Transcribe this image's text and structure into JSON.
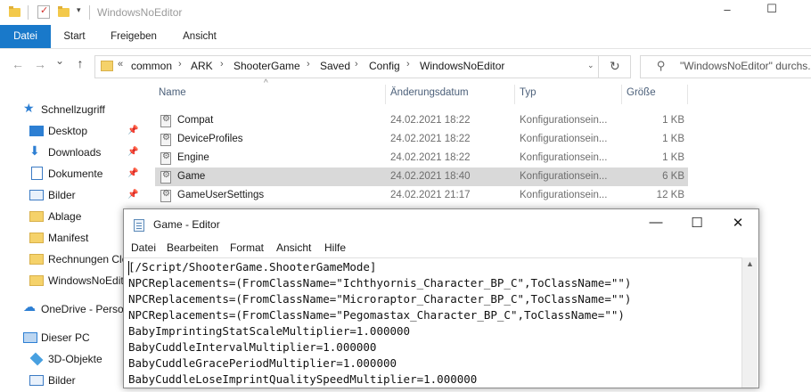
{
  "explorer": {
    "window_title": "WindowsNoEditor",
    "controls": {
      "minimize": "–",
      "maximize": "☐"
    },
    "ribbon_tabs": [
      "Datei",
      "Start",
      "Freigeben",
      "Ansicht"
    ],
    "nav_arrows": {
      "back": "←",
      "forward": "→",
      "recent": "⌄",
      "up": "↑"
    },
    "breadcrumb": [
      "common",
      "ARK",
      "ShooterGame",
      "Saved",
      "Config",
      "WindowsNoEditor"
    ],
    "breadcrumb_overflow": "«",
    "refresh_icon": "↻",
    "search": {
      "placeholder": "\"WindowsNoEditor\" durchs..."
    },
    "sort_indicator": "^",
    "nav_pane": [
      {
        "label": "Schnellzugriff",
        "icon": "star-icon"
      },
      {
        "label": "Desktop",
        "icon": "desktop-icon",
        "pinned": true
      },
      {
        "label": "Downloads",
        "icon": "download-icon",
        "pinned": true
      },
      {
        "label": "Dokumente",
        "icon": "document-icon",
        "pinned": true
      },
      {
        "label": "Bilder",
        "icon": "pictures-icon",
        "pinned": true
      },
      {
        "label": "Ablage",
        "icon": "folder-icon"
      },
      {
        "label": "Manifest",
        "icon": "folder-icon"
      },
      {
        "label": "Rechnungen Clo",
        "icon": "folder-icon"
      },
      {
        "label": "WindowsNoEditor",
        "icon": "folder-icon"
      },
      {
        "label": "OneDrive - Persor",
        "icon": "cloud-icon"
      },
      {
        "label": "Dieser PC",
        "icon": "computer-icon"
      },
      {
        "label": "3D-Objekte",
        "icon": "cube-icon"
      },
      {
        "label": "Bilder",
        "icon": "pictures-icon"
      }
    ],
    "columns": [
      "Name",
      "Änderungsdatum",
      "Typ",
      "Größe"
    ],
    "files": [
      {
        "name": "Compat",
        "date": "24.02.2021 18:22",
        "type": "Konfigurationsein...",
        "size": "1 KB"
      },
      {
        "name": "DeviceProfiles",
        "date": "24.02.2021 18:22",
        "type": "Konfigurationsein...",
        "size": "1 KB"
      },
      {
        "name": "Engine",
        "date": "24.02.2021 18:22",
        "type": "Konfigurationsein...",
        "size": "1 KB"
      },
      {
        "name": "Game",
        "date": "24.02.2021 18:40",
        "type": "Konfigurationsein...",
        "size": "6 KB",
        "selected": true
      },
      {
        "name": "GameUserSettings",
        "date": "24.02.2021 21:17",
        "type": "Konfigurationsein...",
        "size": "12 KB"
      }
    ]
  },
  "editor": {
    "title": "Game - Editor",
    "controls": {
      "minimize": "—",
      "maximize": "☐",
      "close": "✕"
    },
    "menu": [
      "Datei",
      "Bearbeiten",
      "Format",
      "Ansicht",
      "Hilfe"
    ],
    "lines": [
      "[/Script/ShooterGame.ShooterGameMode]",
      "NPCReplacements=(FromClassName=\"Ichthyornis_Character_BP_C\",ToClassName=\"\")",
      "NPCReplacements=(FromClassName=\"Microraptor_Character_BP_C\",ToClassName=\"\")",
      "NPCReplacements=(FromClassName=\"Pegomastax_Character_BP_C\",ToClassName=\"\")",
      "BabyImprintingStatScaleMultiplier=1.000000",
      "BabyCuddleIntervalMultiplier=1.000000",
      "BabyCuddleGracePeriodMultiplier=1.000000",
      "BabyCuddleLoseImprintQualitySpeedMultiplier=1.000000"
    ],
    "scroll_up_icon": "▲"
  }
}
